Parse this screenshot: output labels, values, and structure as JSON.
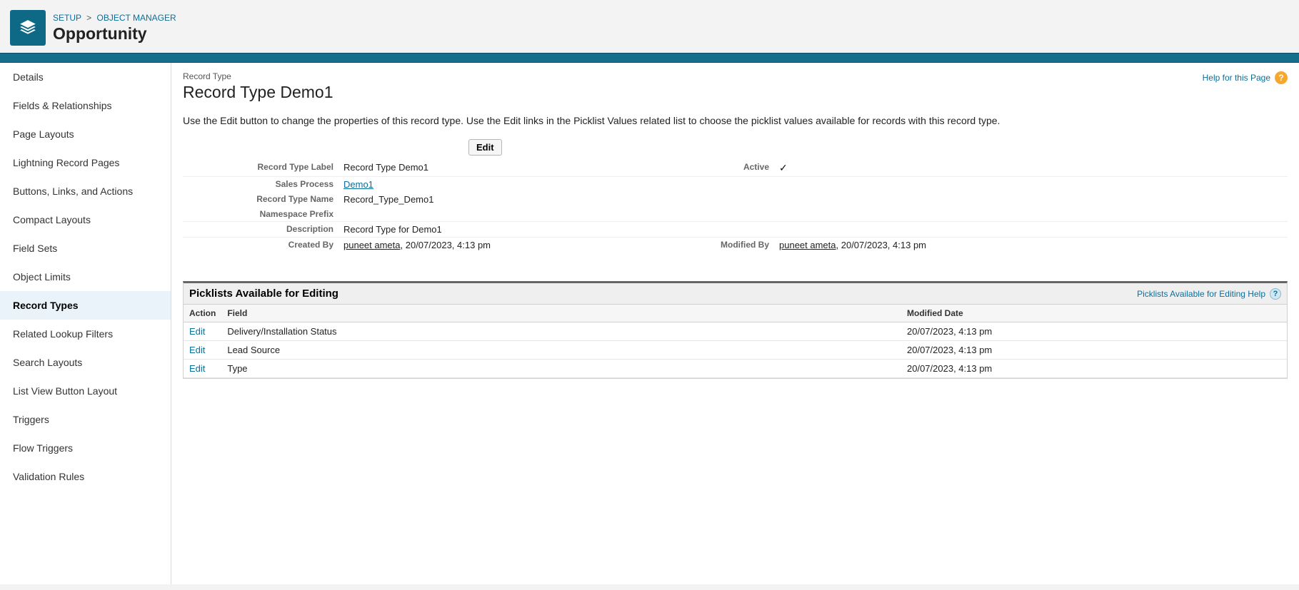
{
  "breadcrumb": {
    "setup": "SETUP",
    "object_manager": "OBJECT MANAGER"
  },
  "object_title": "Opportunity",
  "sidebar": {
    "items": [
      {
        "label": "Details"
      },
      {
        "label": "Fields & Relationships"
      },
      {
        "label": "Page Layouts"
      },
      {
        "label": "Lightning Record Pages"
      },
      {
        "label": "Buttons, Links, and Actions"
      },
      {
        "label": "Compact Layouts"
      },
      {
        "label": "Field Sets"
      },
      {
        "label": "Object Limits"
      },
      {
        "label": "Record Types"
      },
      {
        "label": "Related Lookup Filters"
      },
      {
        "label": "Search Layouts"
      },
      {
        "label": "List View Button Layout"
      },
      {
        "label": "Triggers"
      },
      {
        "label": "Flow Triggers"
      },
      {
        "label": "Validation Rules"
      }
    ],
    "active_index": 8
  },
  "page": {
    "subtitle": "Record Type",
    "title": "Record Type Demo1",
    "help_label": "Help for this Page",
    "intro": "Use the Edit button to change the properties of this record type. Use the Edit links in the Picklist Values related list to choose the picklist values available for records with this record type.",
    "edit_label": "Edit"
  },
  "detail": {
    "labels": {
      "record_type_label": "Record Type Label",
      "active": "Active",
      "sales_process": "Sales Process",
      "record_type_name": "Record Type Name",
      "namespace_prefix": "Namespace Prefix",
      "description": "Description",
      "created_by": "Created By",
      "modified_by": "Modified By"
    },
    "record_type_label": "Record Type Demo1",
    "active_icon": "✓",
    "sales_process": "Demo1",
    "record_type_name": "Record_Type_Demo1",
    "namespace_prefix": "",
    "description": "Record Type for Demo1",
    "created_by_user": "puneet ameta",
    "created_by_date": ", 20/07/2023, 4:13 pm",
    "modified_by_user": "puneet ameta",
    "modified_by_date": ", 20/07/2023, 4:13 pm"
  },
  "picklist": {
    "section_title": "Picklists Available for Editing",
    "help_label": "Picklists Available for Editing Help",
    "columns": {
      "action": "Action",
      "field": "Field",
      "modified": "Modified Date"
    },
    "edit_label": "Edit",
    "rows": [
      {
        "field": "Delivery/Installation Status",
        "modified": "20/07/2023, 4:13 pm"
      },
      {
        "field": "Lead Source",
        "modified": "20/07/2023, 4:13 pm"
      },
      {
        "field": "Type",
        "modified": "20/07/2023, 4:13 pm"
      }
    ]
  }
}
